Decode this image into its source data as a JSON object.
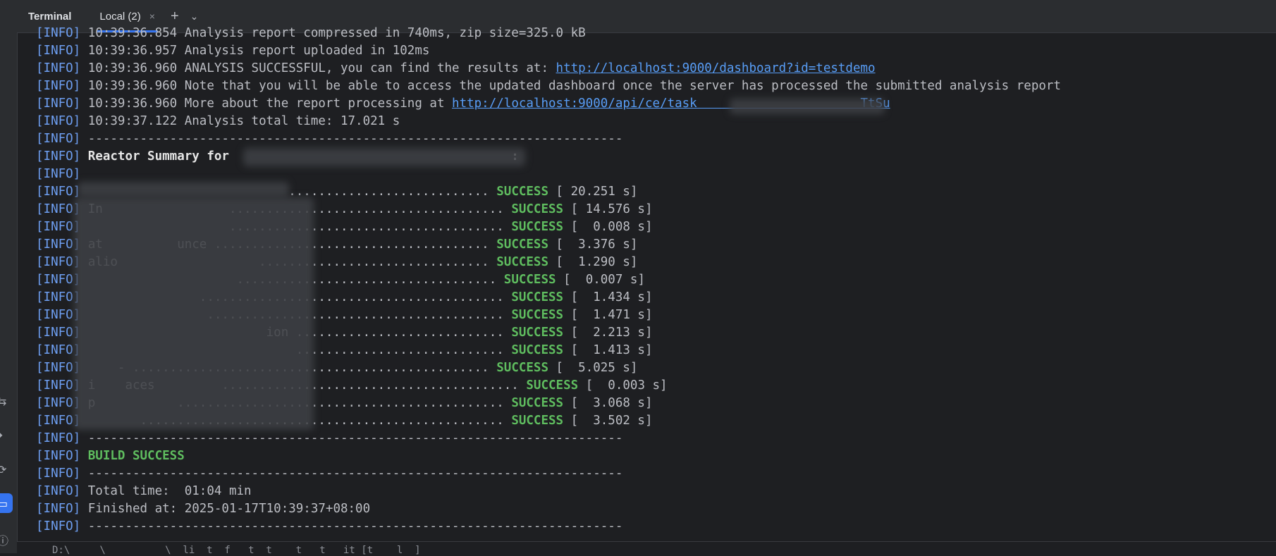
{
  "toolwindow": {
    "title": "Terminal"
  },
  "tabs": [
    {
      "label": "Local (2)",
      "close": "×",
      "active": true
    }
  ],
  "toolbar": {
    "add": "+",
    "menu": "⌄"
  },
  "terminal": {
    "tag": "[INFO]",
    "lines": [
      {
        "text": "10:39:36.854 Analysis report compressed in 740ms, zip size=325.0 kB"
      },
      {
        "text": "10:39:36.957 Analysis report uploaded in 102ms"
      },
      {
        "text": "10:39:36.960 ANALYSIS SUCCESSFUL, you can find the results at: ",
        "link": "http://localhost:9000/dashboard?id=testdemo"
      },
      {
        "text": "10:39:36.960 Note that you will be able to access the updated dashboard once the server has processed the submitted analysis report"
      },
      {
        "text": "10:39:36.960 More about the report processing at ",
        "link": "http://localhost:9000/api/ce/task                      TtSu"
      },
      {
        "text": "10:39:37.122 Analysis total time: 17.021 s"
      },
      {
        "text": "------------------------------------------------------------------------"
      },
      {
        "text": "Reactor Summary for                                      :",
        "bold": true
      },
      {
        "text": ""
      },
      {
        "text": "                           ........................... ",
        "status": "SUCCESS",
        "time": "[ 20.251 s]"
      },
      {
        "text": "In                 ..................................... ",
        "status": "SUCCESS",
        "time": "[ 14.576 s]"
      },
      {
        "text": "                   ..................................... ",
        "status": "SUCCESS",
        "time": "[  0.008 s]"
      },
      {
        "text": "at          unce ..................................... ",
        "status": "SUCCESS",
        "time": "[  3.376 s]"
      },
      {
        "text": "alio                   ............................... ",
        "status": "SUCCESS",
        "time": "[  1.290 s]"
      },
      {
        "text": "                    ................................... ",
        "status": "SUCCESS",
        "time": "[  0.007 s]"
      },
      {
        "text": "               ......................................... ",
        "status": "SUCCESS",
        "time": "[  1.434 s]"
      },
      {
        "text": "                ........................................ ",
        "status": "SUCCESS",
        "time": "[  1.471 s]"
      },
      {
        "text": "                        ion ............................ ",
        "status": "SUCCESS",
        "time": "[  2.213 s]"
      },
      {
        "text": "                            ............................ ",
        "status": "SUCCESS",
        "time": "[  1.413 s]"
      },
      {
        "text": "    - ................................................ ",
        "status": "SUCCESS",
        "time": "[  5.025 s]"
      },
      {
        "text": "i    aces         ........................................ ",
        "status": "SUCCESS",
        "time": "[  0.003 s]"
      },
      {
        "text": "p           ............................................ ",
        "status": "SUCCESS",
        "time": "[  3.068 s]"
      },
      {
        "text": "       ................................................. ",
        "status": "SUCCESS",
        "time": "[  3.502 s]"
      },
      {
        "text": "------------------------------------------------------------------------"
      },
      {
        "text": "",
        "status": "BUILD SUCCESS"
      },
      {
        "text": "------------------------------------------------------------------------"
      },
      {
        "text": "Total time:  01:04 min"
      },
      {
        "text": "Finished at: 2025-01-17T10:39:37+08:00"
      },
      {
        "text": "------------------------------------------------------------------------"
      }
    ],
    "prompt": "D:\\     \\          \\  li  t  f   t  t    t   t   it [t    l  ]"
  },
  "sidebar_icons": [
    "merge-icon",
    "services-icon",
    "build-icon",
    "terminal-icon",
    "problems-icon"
  ]
}
